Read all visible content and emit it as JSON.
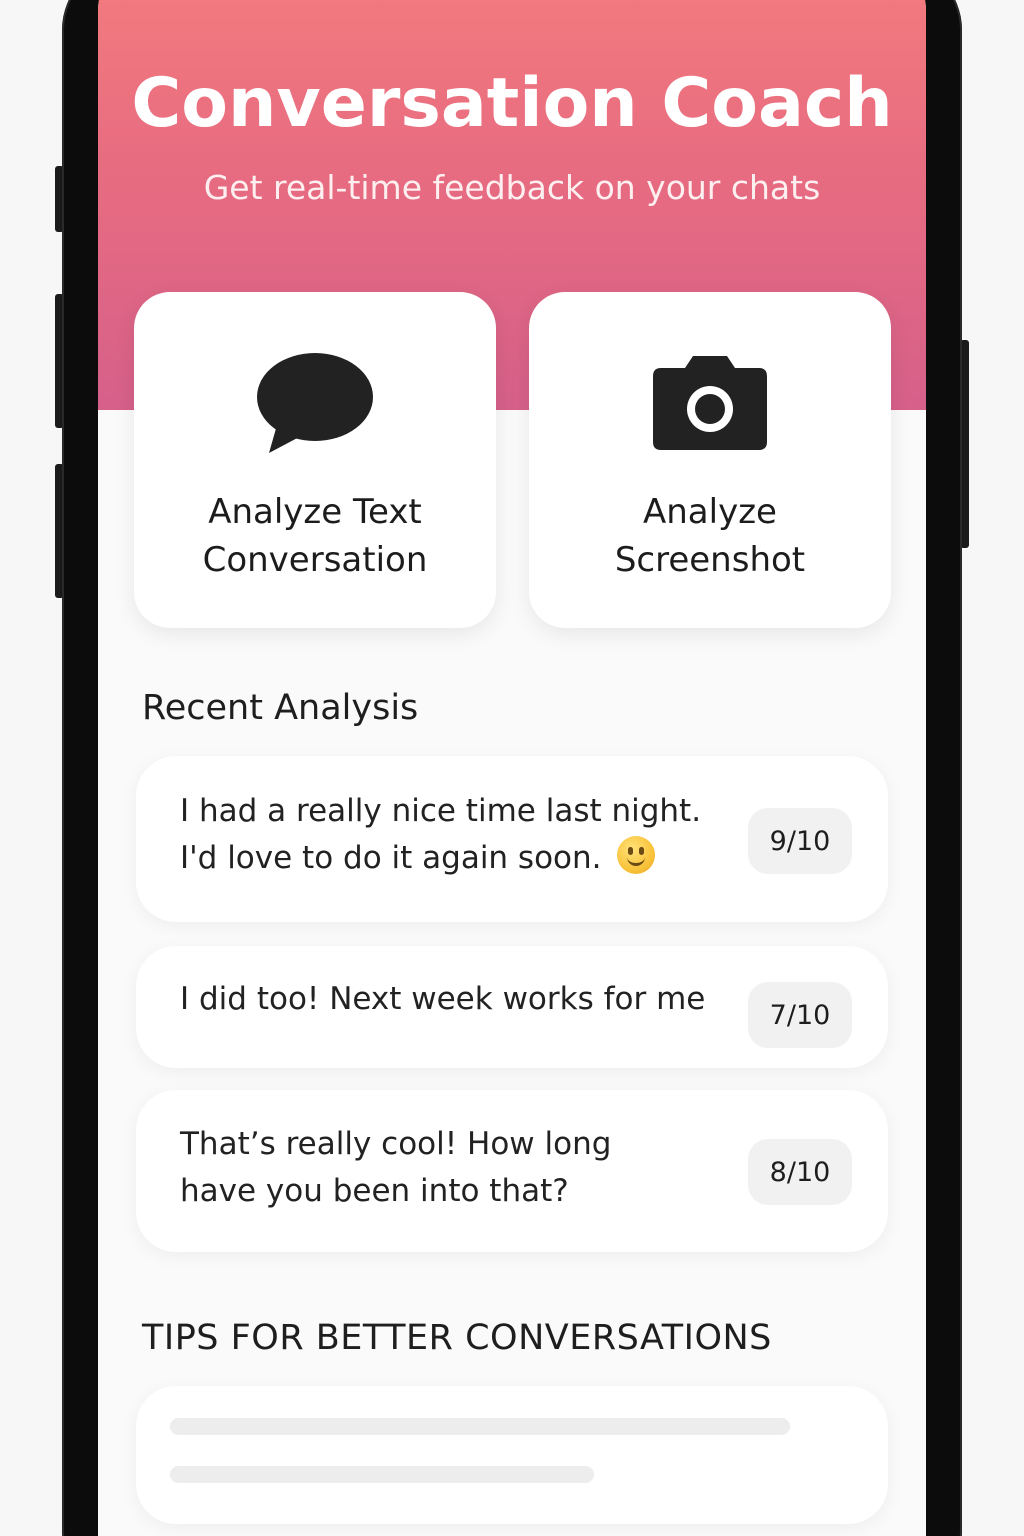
{
  "header": {
    "title": "Conversation Coach",
    "subtitle": "Get real-time feedback on your chats"
  },
  "actions": [
    {
      "label": "Analyze Text\nConversation",
      "icon": "chat-bubble-icon"
    },
    {
      "label": "Analyze\nScreenshot",
      "icon": "camera-icon"
    }
  ],
  "recent": {
    "title": "Recent Analysis",
    "items": [
      {
        "line1": "I had a really nice time last night.",
        "line2": "I'd love to do it again soon.",
        "emoji": "slightly-smiling-face",
        "score": "9/10"
      },
      {
        "line1": "I did too! Next week works for me",
        "line2": "",
        "score": "7/10"
      },
      {
        "line1": "That’s really cool! How long",
        "line2": "have you been into that?",
        "score": "8/10"
      }
    ]
  },
  "tips": {
    "title": "TIPS FOR BETTER CONVERSATIONS"
  },
  "colors": {
    "gradient_top": "#f47c7e",
    "gradient_bottom": "#d6608a",
    "icon": "#222222",
    "badge_bg": "#f1f1f1"
  }
}
